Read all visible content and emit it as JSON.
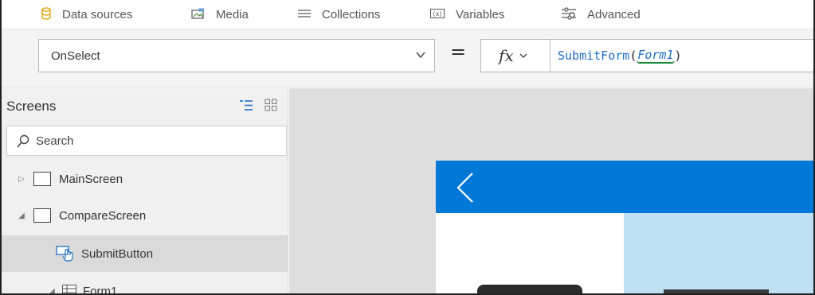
{
  "ribbon": {
    "items": [
      {
        "label": "Data sources",
        "icon": "cylinder-icon"
      },
      {
        "label": "Media",
        "icon": "image-icon"
      },
      {
        "label": "Collections",
        "icon": "list-icon"
      },
      {
        "label": "Variables",
        "icon": "variable-icon"
      },
      {
        "label": "Advanced",
        "icon": "sliders-icon"
      }
    ]
  },
  "formula": {
    "property": "OnSelect",
    "equals": "=",
    "fx": "fx",
    "function_name": "SubmitForm",
    "open_paren": "(",
    "argument": "Form1",
    "close_paren": ")"
  },
  "tree": {
    "header": "Screens",
    "search_placeholder": "Search",
    "items": [
      {
        "label": "MainScreen",
        "expanded": false
      },
      {
        "label": "CompareScreen",
        "expanded": true
      },
      {
        "label": "SubmitButton",
        "selected": true
      },
      {
        "label": "Form1",
        "expanded": true
      }
    ]
  },
  "colors": {
    "accent": "#0078d7",
    "selected_row": "#dadada",
    "canvas_bg": "#dedede",
    "form_highlight": "#bfe0f3"
  }
}
